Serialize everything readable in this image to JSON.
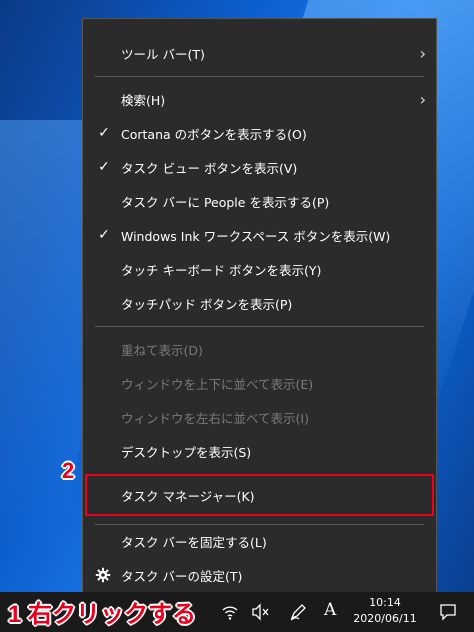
{
  "menu": {
    "items": [
      {
        "label": "ツール バー(T)",
        "checked": false,
        "submenu": true,
        "disabled": false
      },
      {
        "label": "検索(H)",
        "checked": false,
        "submenu": true,
        "disabled": false
      },
      {
        "label": "Cortana のボタンを表示する(O)",
        "checked": true,
        "submenu": false,
        "disabled": false
      },
      {
        "label": "タスク ビュー ボタンを表示(V)",
        "checked": true,
        "submenu": false,
        "disabled": false
      },
      {
        "label": "タスク バーに People を表示する(P)",
        "checked": false,
        "submenu": false,
        "disabled": false
      },
      {
        "label": "Windows Ink ワークスペース ボタンを表示(W)",
        "checked": true,
        "submenu": false,
        "disabled": false
      },
      {
        "label": "タッチ キーボード ボタンを表示(Y)",
        "checked": false,
        "submenu": false,
        "disabled": false
      },
      {
        "label": "タッチパッド ボタンを表示(P)",
        "checked": false,
        "submenu": false,
        "disabled": false
      },
      {
        "label": "重ねて表示(D)",
        "checked": false,
        "submenu": false,
        "disabled": true
      },
      {
        "label": "ウィンドウを上下に並べて表示(E)",
        "checked": false,
        "submenu": false,
        "disabled": true
      },
      {
        "label": "ウィンドウを左右に並べて表示(I)",
        "checked": false,
        "submenu": false,
        "disabled": true
      },
      {
        "label": "デスクトップを表示(S)",
        "checked": false,
        "submenu": false,
        "disabled": false
      },
      {
        "label": "タスク マネージャー(K)",
        "checked": false,
        "submenu": false,
        "disabled": false
      },
      {
        "label": "タスク バーを固定する(L)",
        "checked": false,
        "submenu": false,
        "disabled": false
      },
      {
        "label": "タスク バーの設定(T)",
        "checked": false,
        "submenu": false,
        "disabled": false,
        "icon": "gear-icon"
      }
    ],
    "check_glyph": "✓",
    "arrow_glyph": "›"
  },
  "annotations": {
    "step1": "1 右クリックする",
    "step2": "2",
    "highlight_color": "#e8001c"
  },
  "taskbar": {
    "time": "10:14",
    "date": "2020/06/11",
    "ime_label": "A",
    "icons": [
      "network-icon",
      "volume-muted-icon",
      "pen-icon",
      "ime-icon",
      "notification-icon"
    ]
  }
}
